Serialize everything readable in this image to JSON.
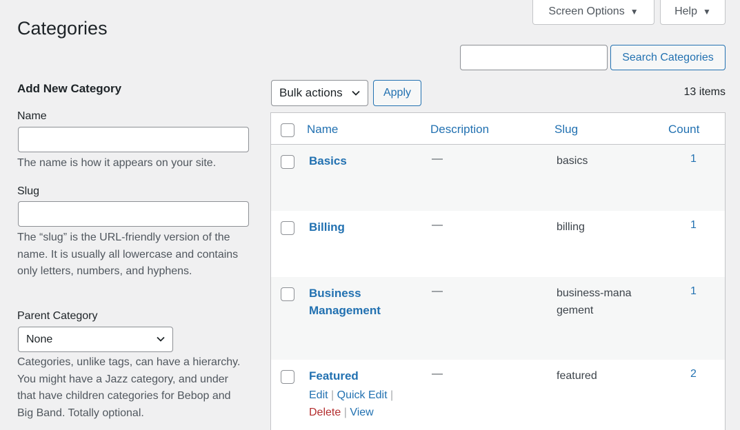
{
  "header": {
    "screen_options": "Screen Options",
    "help": "Help",
    "dropdown_arrow": "▼",
    "title": "Categories"
  },
  "search": {
    "button": "Search Categories"
  },
  "form": {
    "heading": "Add New Category",
    "name_label": "Name",
    "name_help": "The name is how it appears on your site.",
    "slug_label": "Slug",
    "slug_help": "The “slug” is the URL-friendly version of the name. It is usually all lowercase and contains only letters, numbers, and hyphens.",
    "parent_label": "Parent Category",
    "parent_value": "None",
    "parent_help": "Categories, unlike tags, can have a hierarchy. You might have a Jazz category, and under that have children categories for Bebop and Big Band. Totally optional."
  },
  "toolbar": {
    "bulk_actions": "Bulk actions",
    "apply": "Apply",
    "item_count": "13 items"
  },
  "table": {
    "columns": {
      "name": "Name",
      "description": "Description",
      "slug": "Slug",
      "count": "Count"
    },
    "rows": [
      {
        "name": "Basics",
        "description": "—",
        "slug": "basics",
        "count": "1"
      },
      {
        "name": "Billing",
        "description": "—",
        "slug": "billing",
        "count": "1"
      },
      {
        "name": "Business Management",
        "description": "—",
        "slug": "business-management",
        "count": "1"
      },
      {
        "name": "Featured",
        "description": "—",
        "slug": "featured",
        "count": "2"
      }
    ],
    "row_actions": {
      "edit": "Edit",
      "quick_edit": "Quick Edit",
      "delete": "Delete",
      "view": "View",
      "separator": "|"
    }
  },
  "colors": {
    "accent": "#2271b1",
    "delete": "#b32d2e",
    "background": "#f0f0f1"
  }
}
